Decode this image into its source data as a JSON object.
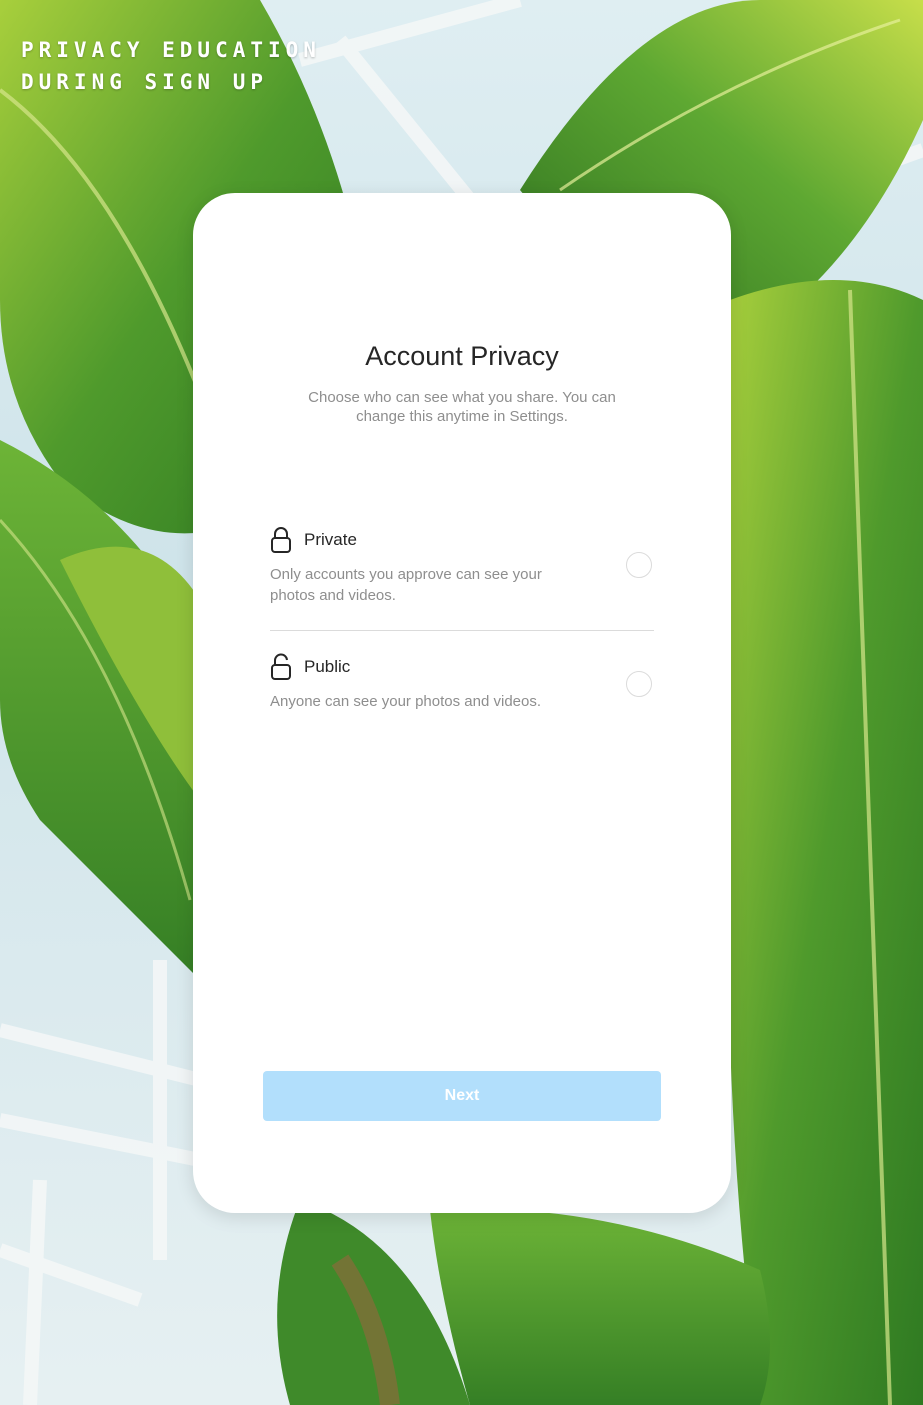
{
  "caption": {
    "line1": "Privacy Education",
    "line2": "During Sign Up"
  },
  "screen": {
    "title": "Account Privacy",
    "subtitle": "Choose who can see what you share. You can change this anytime in Settings.",
    "options": [
      {
        "icon": "lock-icon",
        "label": "Private",
        "description": "Only accounts you approve can see your photos and videos.",
        "selected": false
      },
      {
        "icon": "unlock-icon",
        "label": "Public",
        "description": "Anyone can see your photos and videos.",
        "selected": false
      }
    ],
    "next_label": "Next"
  },
  "colors": {
    "button_disabled": "#b2dffc",
    "text_primary": "#262626",
    "text_secondary": "#8e8e8e",
    "divider": "#dbdbdb",
    "leaf_green": "#4f9a2c"
  }
}
